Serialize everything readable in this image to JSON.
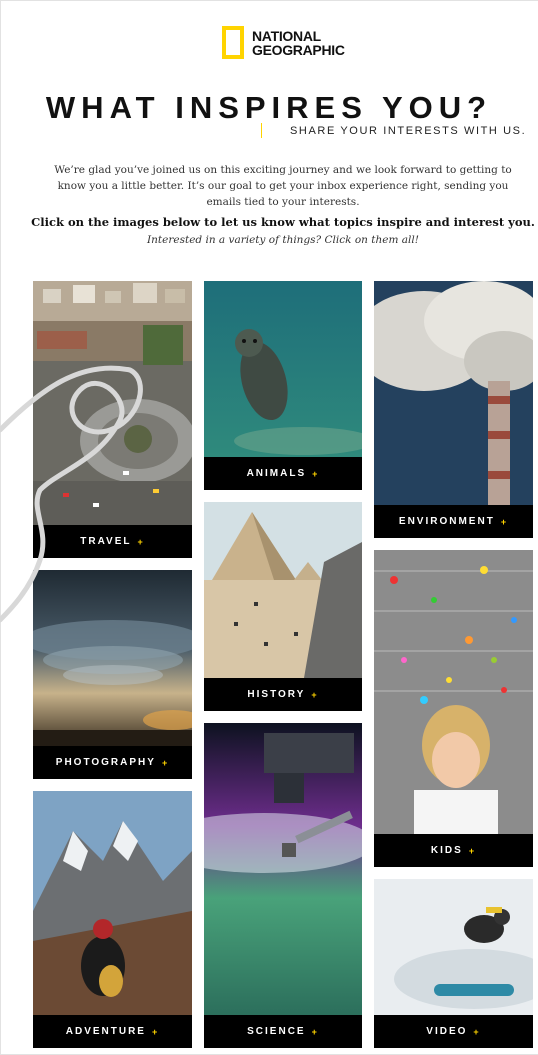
{
  "brand": {
    "line1": "NATIONAL",
    "line2": "GEOGRAPHIC"
  },
  "headline": "WHAT INSPIRES YOU?",
  "subhead": "SHARE YOUR INTERESTS WITH US.",
  "intro": "We’re glad you’ve joined us on this exciting journey and we look forward to getting to know you a little better. It’s our goal to get your inbox experience right, sending you emails tied to your interests.",
  "cta": "Click on the images below to let us know what topics inspire and interest you.",
  "hint": "Interested in a variety of things? Click on them all!",
  "plus_symbol": "+",
  "tiles": {
    "travel": "TRAVEL",
    "photography": "PHOTOGRAPHY",
    "adventure": "ADVENTURE",
    "animals": "ANIMALS",
    "history": "HISTORY",
    "science": "SCIENCE",
    "environment": "ENVIRONMENT",
    "kids": "KIDS",
    "video": "VIDEO"
  },
  "colors": {
    "accent": "#ffd400",
    "label_bg": "#000000"
  }
}
